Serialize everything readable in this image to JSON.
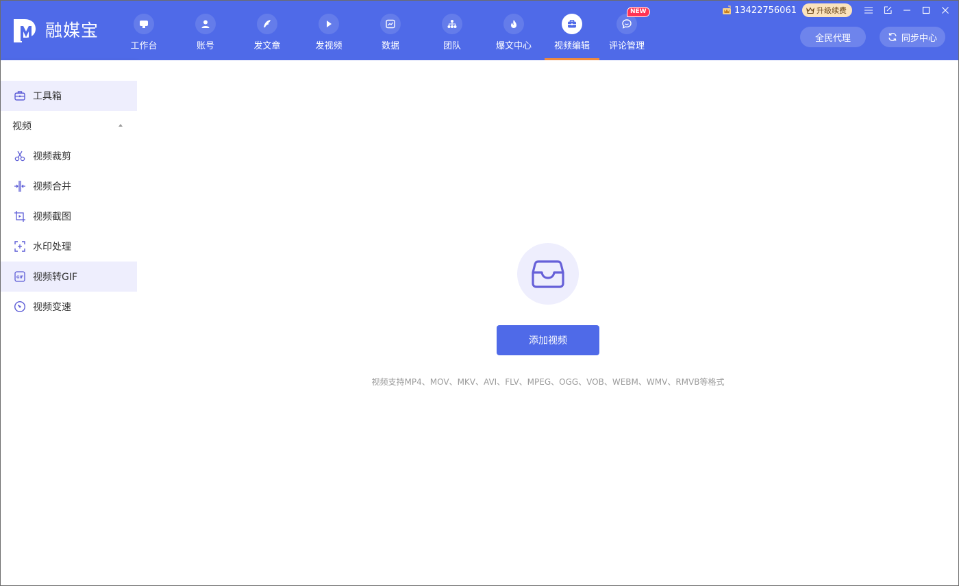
{
  "app": {
    "name": "融媒宝"
  },
  "nav": [
    {
      "label": "工作台",
      "icon": "monitor-icon"
    },
    {
      "label": "账号",
      "icon": "user-icon"
    },
    {
      "label": "发文章",
      "icon": "feather-icon"
    },
    {
      "label": "发视频",
      "icon": "play-icon"
    },
    {
      "label": "数据",
      "icon": "chart-icon"
    },
    {
      "label": "团队",
      "icon": "team-icon"
    },
    {
      "label": "爆文中心",
      "icon": "flame-icon"
    },
    {
      "label": "视频编辑",
      "icon": "toolbox-icon",
      "active": true
    },
    {
      "label": "评论管理",
      "icon": "comment-icon",
      "badge": "NEW"
    }
  ],
  "topbar": {
    "phone": "13422756061",
    "upgrade_label": "升级续费",
    "agent_label": "全民代理",
    "sync_label": "同步中心"
  },
  "sidebar": {
    "toolbox_label": "工具箱",
    "group_label": "视频",
    "items": [
      {
        "label": "视频裁剪",
        "icon": "scissors-icon"
      },
      {
        "label": "视频合并",
        "icon": "merge-icon"
      },
      {
        "label": "视频截图",
        "icon": "screenshot-icon"
      },
      {
        "label": "水印处理",
        "icon": "watermark-icon"
      },
      {
        "label": "视频转GIF",
        "icon": "gif-icon",
        "highlighted": true
      },
      {
        "label": "视频变速",
        "icon": "speed-icon"
      }
    ]
  },
  "main": {
    "add_button_label": "添加视频",
    "hint": "视频支持MP4、MOV、MKV、AVI、FLV、MPEG、OGG、VOB、WEBM、WMV、RMVB等格式"
  },
  "colors": {
    "header": "#4f6ae8",
    "accent": "#4f6ae8",
    "active_underline": "#f08a3c",
    "icon_purple": "#5b5bd6",
    "highlight_bg": "#eeeefd",
    "badge": "#ff3355"
  }
}
